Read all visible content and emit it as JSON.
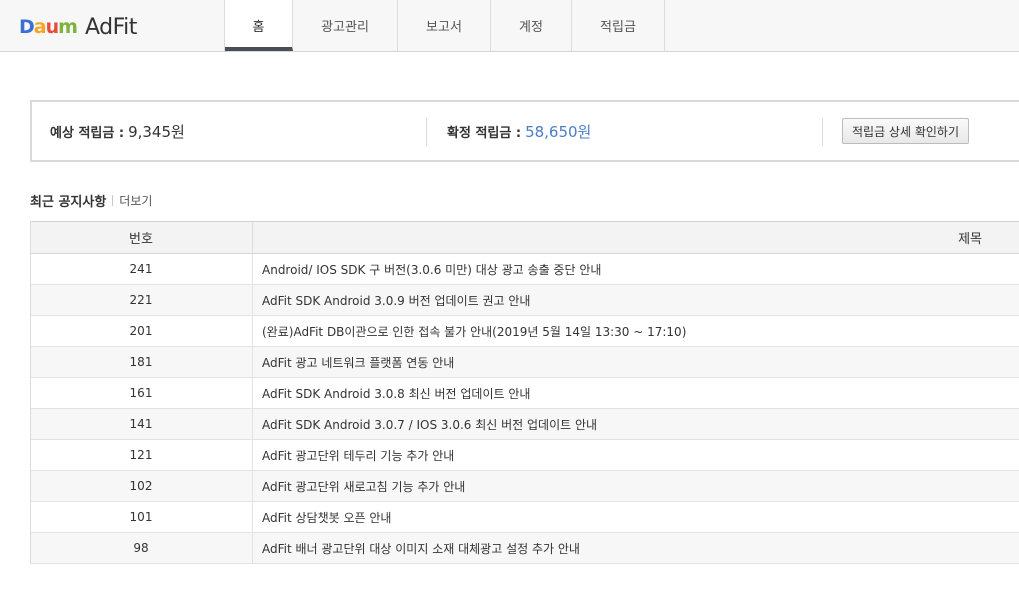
{
  "header": {
    "logo_parts": [
      "D",
      "a",
      "u",
      "m"
    ],
    "logo_product": "AdFit",
    "tabs": [
      {
        "label": "홈",
        "active": true,
        "width": 68
      },
      {
        "label": "광고관리",
        "active": false,
        "width": 105
      },
      {
        "label": "보고서",
        "active": false,
        "width": 93
      },
      {
        "label": "계정",
        "active": false,
        "width": 81
      },
      {
        "label": "적립금",
        "active": false,
        "width": 93
      }
    ]
  },
  "summary": {
    "expected_label": "예상 적립금 :",
    "expected_value": "9,345원",
    "confirmed_label": "확정 적립금 :",
    "confirmed_value": "58,650원",
    "detail_button": "적립금 상세 확인하기"
  },
  "notices": {
    "title": "최근 공지사항",
    "more": "더보기",
    "columns": [
      "번호",
      "제목"
    ],
    "rows": [
      {
        "no": "241",
        "title": "Android/ IOS SDK 구 버전(3.0.6 미만) 대상 광고 송출 중단 안내"
      },
      {
        "no": "221",
        "title": "AdFit SDK Android 3.0.9 버전 업데이트 권고 안내"
      },
      {
        "no": "201",
        "title": "(완료)AdFit DB이관으로 인한 접속 불가 안내(2019년 5월 14일 13:30 ~ 17:10)"
      },
      {
        "no": "181",
        "title": "AdFit 광고 네트워크 플랫폼 연동 안내"
      },
      {
        "no": "161",
        "title": "AdFit SDK Android 3.0.8 최신 버전 업데이트 안내"
      },
      {
        "no": "141",
        "title": "AdFit SDK Android 3.0.7 / IOS 3.0.6 최신 버전 업데이트 안내"
      },
      {
        "no": "121",
        "title": "AdFit 광고단위 테두리 기능 추가 안내"
      },
      {
        "no": "102",
        "title": "AdFit 광고단위 새로고침 기능 추가 안내"
      },
      {
        "no": "101",
        "title": "AdFit 상담챗봇 오픈 안내"
      },
      {
        "no": "98",
        "title": "AdFit 배너 광고단위 대상 이미지 소재 대체광고 설정 추가 안내"
      }
    ]
  }
}
